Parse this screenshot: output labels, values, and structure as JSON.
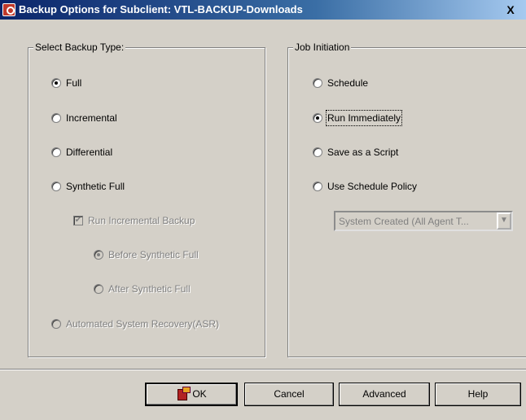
{
  "window": {
    "title": "Backup Options for Subclient: VTL-BACKUP-Downloads",
    "close_label": "X"
  },
  "backup_type": {
    "legend": "Select Backup Type:",
    "options": [
      {
        "label": "Full",
        "checked": true,
        "enabled": true
      },
      {
        "label": "Incremental",
        "checked": false,
        "enabled": true
      },
      {
        "label": "Differential",
        "checked": false,
        "enabled": true
      },
      {
        "label": "Synthetic Full",
        "checked": false,
        "enabled": true
      }
    ],
    "run_incremental_label": "Run Incremental Backup",
    "run_incremental_checked": true,
    "before_synthetic_label": "Before Synthetic Full",
    "after_synthetic_label": "After Synthetic Full",
    "asr_label": "Automated System Recovery(ASR)"
  },
  "job_initiation": {
    "legend": "Job Initiation",
    "options": [
      {
        "label": "Schedule",
        "checked": false
      },
      {
        "label": "Run Immediately",
        "checked": true
      },
      {
        "label": "Save as a Script",
        "checked": false
      },
      {
        "label": "Use Schedule Policy",
        "checked": false
      }
    ],
    "policy_select_value": "System Created (All  Agent T..."
  },
  "buttons": {
    "ok": "OK",
    "cancel": "Cancel",
    "advanced": "Advanced",
    "help": "Help"
  }
}
